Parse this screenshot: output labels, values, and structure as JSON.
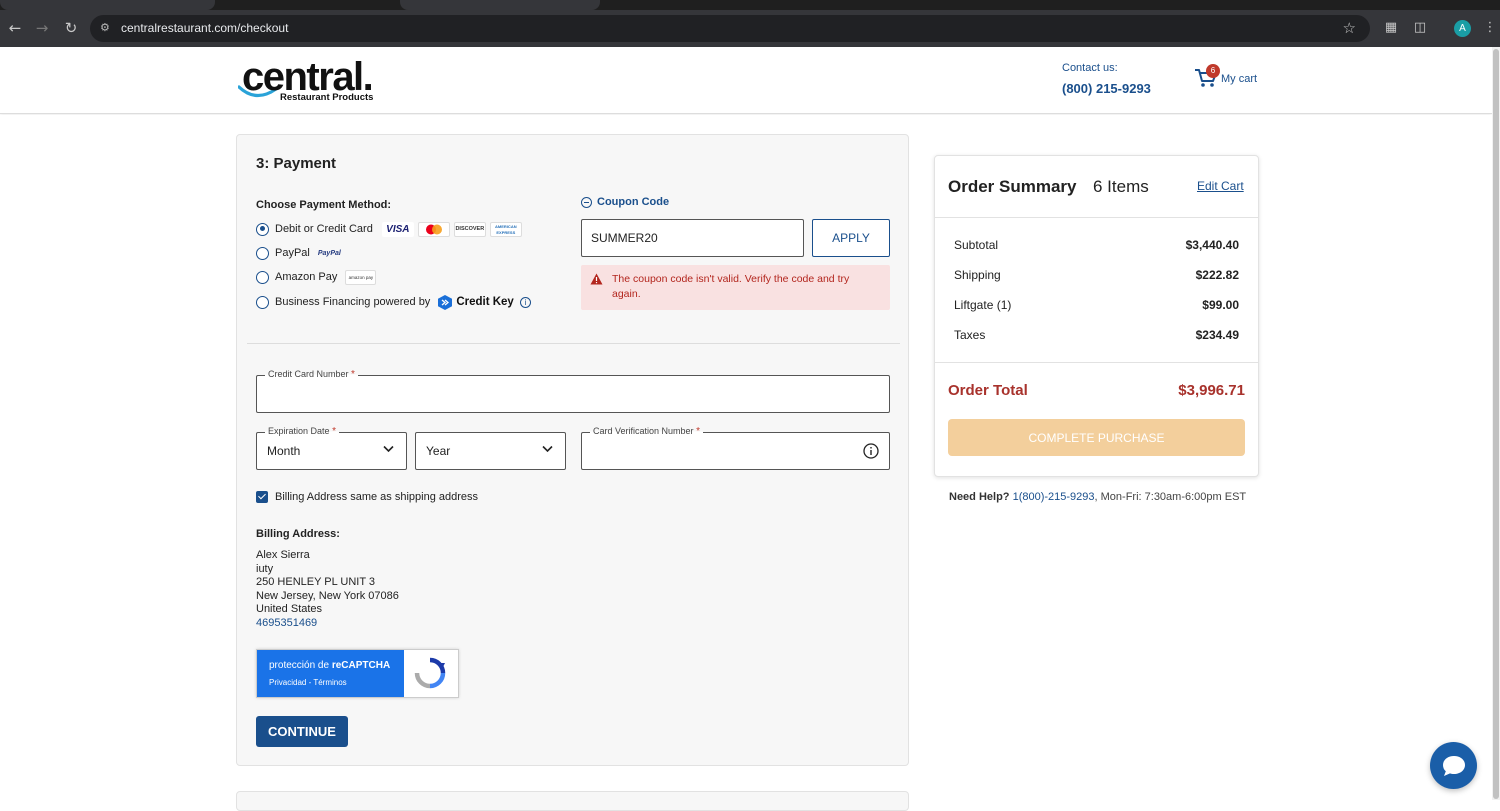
{
  "browser": {
    "url": "centralrestaurant.com/checkout",
    "profile_initial": "A"
  },
  "header": {
    "logo_word": "central.",
    "logo_sub": "Restaurant Products",
    "contact_label": "Contact us:",
    "contact_phone": "(800) 215-9293",
    "cart_count": "6",
    "cart_label": "My cart"
  },
  "payment": {
    "title": "3: Payment",
    "method_label": "Choose Payment Method:",
    "methods": [
      {
        "label": "Debit or Credit Card",
        "selected": true
      },
      {
        "label": "PayPal",
        "selected": false
      },
      {
        "label": "Amazon Pay",
        "selected": false
      },
      {
        "label": "Business Financing powered by",
        "selected": false
      }
    ],
    "card_logos": [
      "VISA",
      "mastercard",
      "DISCOVER",
      "AMERICAN EXPRESS"
    ],
    "paypal_logo": "PayPal",
    "amazon_logo": "amazon pay",
    "credit_key_label": "Credit Key",
    "coupon": {
      "toggle_label": "Coupon Code",
      "value": "SUMMER20",
      "apply_label": "APPLY",
      "error": "The coupon code isn't valid. Verify the code and try again."
    },
    "card_number_label": "Credit Card Number",
    "expiration_label": "Expiration Date",
    "month_value": "Month",
    "year_value": "Year",
    "cvv_label": "Card Verification Number",
    "required_mark": "*",
    "billing_same_label": "Billing Address same as shipping address",
    "billing_same_checked": true,
    "billing_title": "Billing Address:",
    "billing_address": {
      "name": "Alex Sierra",
      "company": "iuty",
      "street": "250 HENLEY PL UNIT 3",
      "city_line": "New Jersey, New York 07086",
      "country": "United States",
      "phone": "4695351469"
    },
    "recaptcha": {
      "line1_prefix": "protección de ",
      "line1_brand": "reCAPTCHA",
      "line2": "Privacidad - Términos"
    },
    "continue_label": "CONTINUE"
  },
  "summary": {
    "title": "Order Summary",
    "items_count": "6 Items",
    "edit_cart_label": "Edit Cart",
    "rows": [
      {
        "label": "Subtotal",
        "value": "$3,440.40"
      },
      {
        "label": "Shipping",
        "value": "$222.82"
      },
      {
        "label": "Liftgate (1)",
        "value": "$99.00"
      },
      {
        "label": "Taxes",
        "value": "$234.49"
      }
    ],
    "total_label": "Order Total",
    "total_value": "$3,996.71",
    "purchase_label": "COMPLETE PURCHASE"
  },
  "help": {
    "prefix": "Need Help?",
    "phone": "1(800)-215-9293",
    "hours": ", Mon-Fri: 7:30am-6:00pm EST"
  },
  "colors": {
    "brand_blue": "#1a4f8c",
    "error_red": "#b3261e",
    "total_red": "#a8322c",
    "purchase_disabled": "#f3cf9c"
  }
}
